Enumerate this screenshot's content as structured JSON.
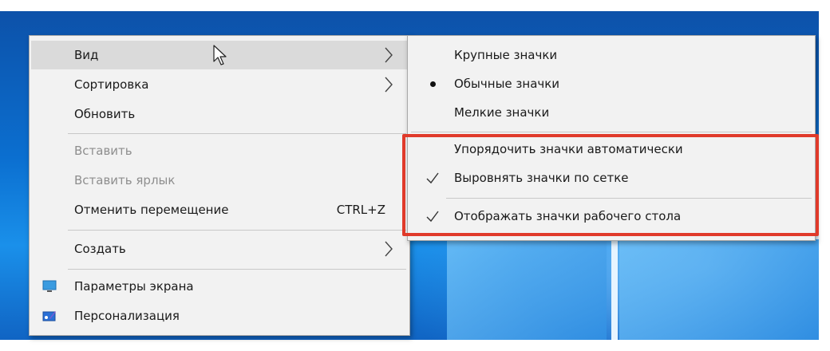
{
  "colors": {
    "menu_bg": "#f2f2f2",
    "hover_bg": "#dadada",
    "disabled_text": "#8e8e8e",
    "highlight": "#e03a2a",
    "desktop": "#0b6fd0"
  },
  "context_menu": {
    "items": [
      {
        "label": "Вид",
        "has_submenu": true,
        "hover": true
      },
      {
        "label": "Сортировка",
        "has_submenu": true
      },
      {
        "label": "Обновить"
      },
      {
        "label": "Вставить",
        "disabled": true
      },
      {
        "label": "Вставить ярлык",
        "disabled": true
      },
      {
        "label": "Отменить перемещение",
        "shortcut": "CTRL+Z"
      },
      {
        "label": "Создать",
        "has_submenu": true
      },
      {
        "label": "Параметры экрана",
        "icon": "display-settings-icon"
      },
      {
        "label": "Персонализация",
        "icon": "personalization-icon"
      }
    ]
  },
  "view_submenu": {
    "items": [
      {
        "label": "Крупные значки"
      },
      {
        "label": "Обычные значки",
        "mark": "bullet"
      },
      {
        "label": "Мелкие значки"
      },
      {
        "label": "Упорядочить значки автоматически"
      },
      {
        "label": "Выровнять значки по сетке",
        "mark": "check"
      },
      {
        "label": "Отображать значки рабочего стола",
        "mark": "check"
      }
    ]
  }
}
